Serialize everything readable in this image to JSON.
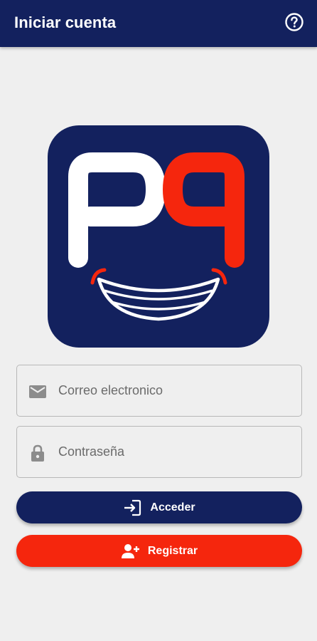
{
  "appbar": {
    "title": "Iniciar cuenta",
    "help_icon": "help-circle-icon"
  },
  "logo": {
    "text": "PP",
    "colors": {
      "background": "#13215e",
      "left_letter": "#ffffff",
      "right_letter": "#f5260d"
    }
  },
  "form": {
    "email": {
      "placeholder": "Correo electronico",
      "value": "",
      "icon": "email-icon"
    },
    "password": {
      "placeholder": "Contraseña",
      "value": "",
      "icon": "lock-icon"
    }
  },
  "buttons": {
    "login": {
      "label": "Acceder",
      "icon": "login-icon"
    },
    "register": {
      "label": "Registrar",
      "icon": "add-user-icon"
    }
  },
  "colors": {
    "primary": "#13215e",
    "accent": "#f5260d",
    "background": "#efefef"
  }
}
